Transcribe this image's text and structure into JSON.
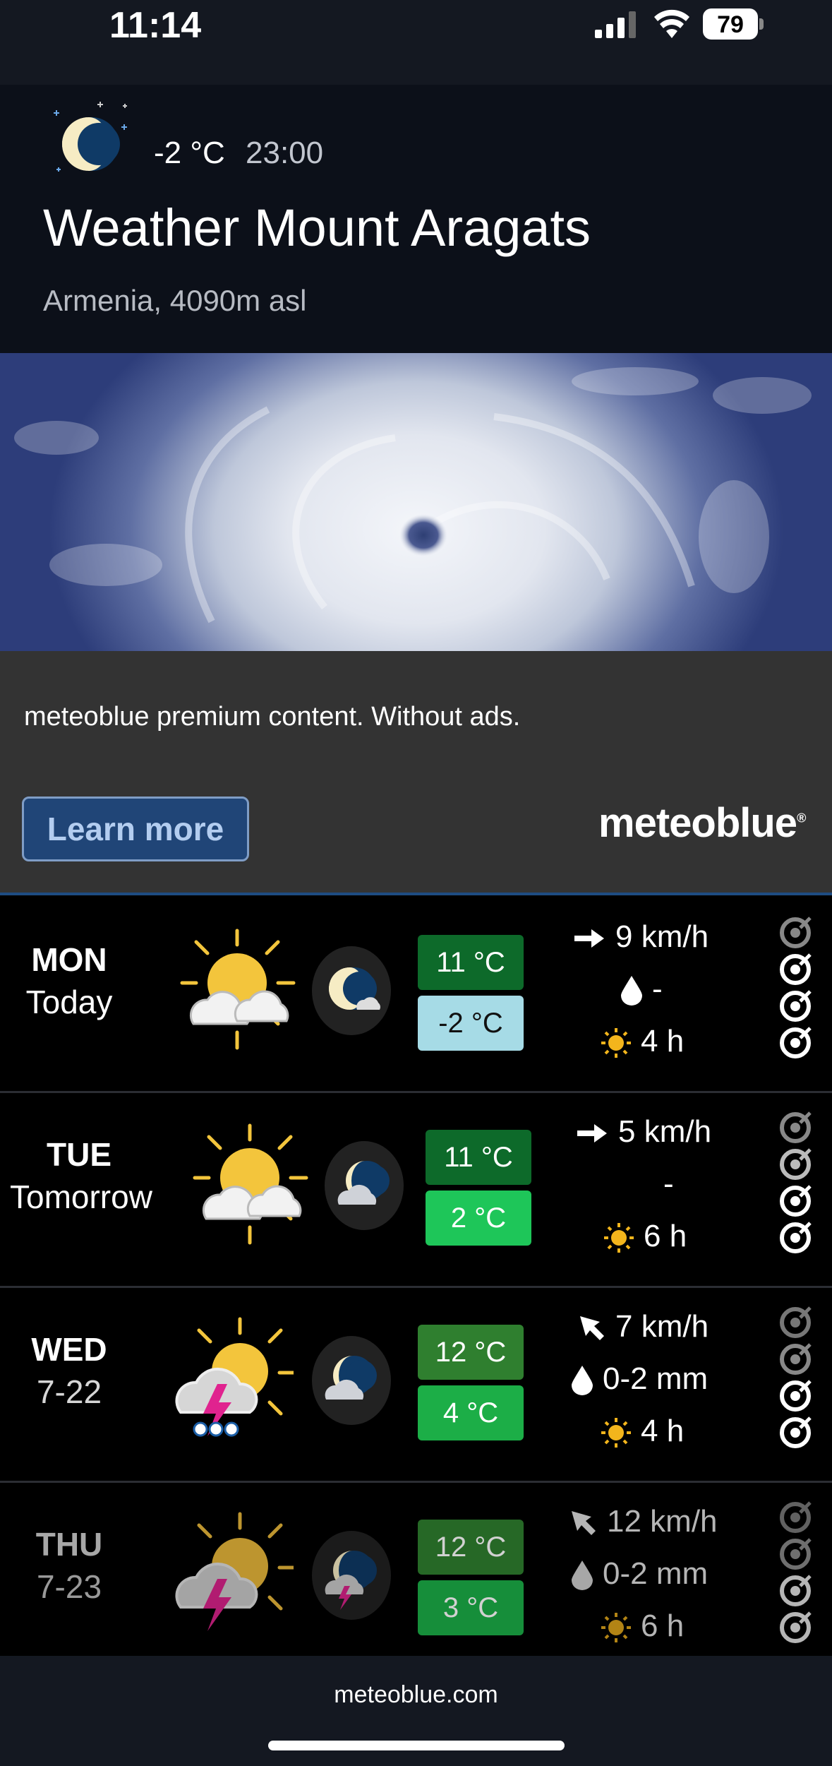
{
  "status_bar": {
    "time": "11:14",
    "battery": "79"
  },
  "header": {
    "current_temp": "-2 °C",
    "current_time": "23:00",
    "title": "Weather Mount Aragats",
    "subtitle": "Armenia, 4090m asl",
    "icon": "moon-clear-night-icon"
  },
  "promo": {
    "text": "meteoblue premium content. Without ads.",
    "button_label": "Learn more",
    "brand": "meteoblue"
  },
  "forecast": [
    {
      "day": "MON",
      "sub": "Today",
      "day_icon": "sun-clouds-icon",
      "night_icon": "moon-cloud-icon",
      "max": "11 °C",
      "min": "-2 °C",
      "max_color": "#0d6a2a",
      "min_color": "#a6dbe6",
      "wind": "9 km/h",
      "wind_icon": "arrow-right-icon",
      "precip": "-",
      "sun": "4 h"
    },
    {
      "day": "TUE",
      "sub": "Tomorrow",
      "day_icon": "sun-clouds-icon",
      "night_icon": "moon-cloud-icon",
      "max": "11 °C",
      "min": "2 °C",
      "max_color": "#0d6a2a",
      "min_color": "#1ec659",
      "wind": "5 km/h",
      "wind_icon": "arrow-right-icon",
      "precip": "-",
      "sun": "6 h"
    },
    {
      "day": "WED",
      "sub": "7-22",
      "day_icon": "thunderstorm-rain-icon",
      "night_icon": "moon-cloud-icon",
      "max": "12 °C",
      "min": "4 °C",
      "max_color": "#2f7f2f",
      "min_color": "#1cae47",
      "wind": "7 km/h",
      "wind_icon": "arrow-northwest-icon",
      "precip": "0-2 mm",
      "sun": "4 h"
    },
    {
      "day": "THU",
      "sub": "7-23",
      "day_icon": "thunderstorm-icon",
      "night_icon": "moon-thunder-icon",
      "max": "12 °C",
      "min": "3 °C",
      "max_color": "#2f7f2f",
      "min_color": "#1cae47",
      "wind": "12 km/h",
      "wind_icon": "arrow-northwest-icon",
      "precip": "0-2 mm",
      "sun": "6 h"
    }
  ],
  "footer": {
    "link": "meteoblue.com"
  },
  "colors": {
    "header_bg": "#0c1019",
    "promo_bg": "#333333",
    "button_bg": "#204577"
  }
}
